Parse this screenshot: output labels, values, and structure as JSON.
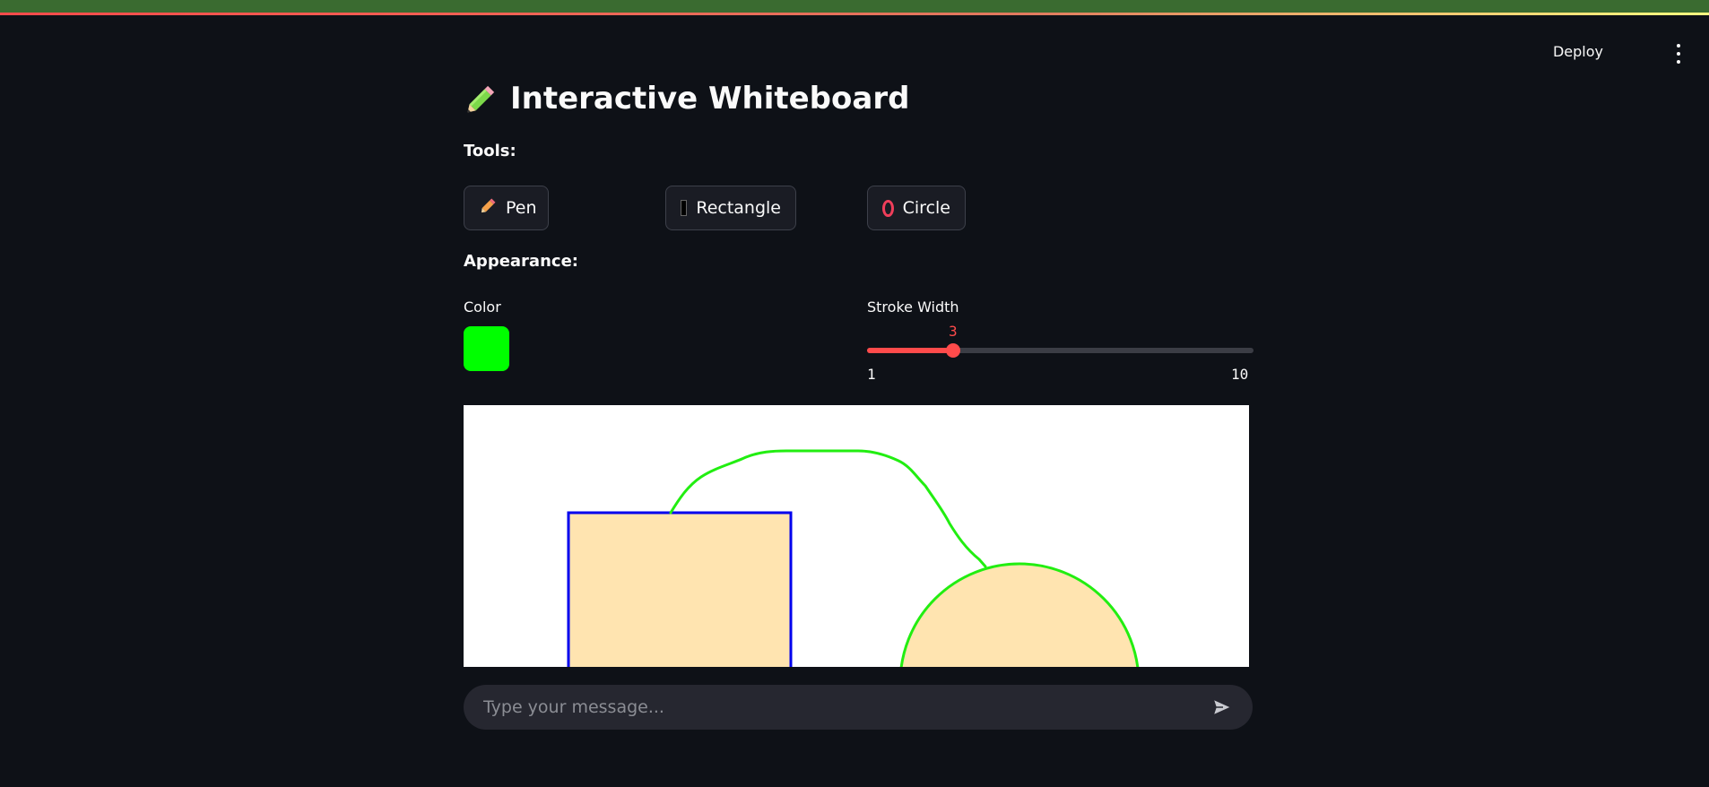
{
  "header": {
    "deploy_label": "Deploy",
    "menu_icon": "kebab-menu-icon"
  },
  "page": {
    "title": "Interactive Whiteboard",
    "title_icon": "pencil-icon"
  },
  "tools": {
    "label": "Tools:",
    "buttons": [
      {
        "label": "Pen",
        "icon": "pencil-icon"
      },
      {
        "label": "Rectangle",
        "icon": "black-square-icon"
      },
      {
        "label": "Circle",
        "icon": "ring-icon"
      }
    ]
  },
  "appearance": {
    "label": "Appearance:",
    "color_label": "Color",
    "color_value": "#00ff00",
    "stroke_label": "Stroke Width",
    "stroke_value": "3",
    "stroke_min": "1",
    "stroke_max": "10"
  },
  "canvas": {
    "background": "#ffffff",
    "rectangle": {
      "fill": "#ffe4b0",
      "stroke": "#0000ee"
    },
    "circle": {
      "fill": "#ffe4b0",
      "stroke": "#22ee11"
    },
    "pen_path": {
      "stroke": "#22ee11"
    }
  },
  "chat": {
    "placeholder": "Type your message...",
    "send_icon": "send-icon"
  },
  "colors": {
    "accent": "#ff4b4b",
    "background": "#0e1117"
  }
}
